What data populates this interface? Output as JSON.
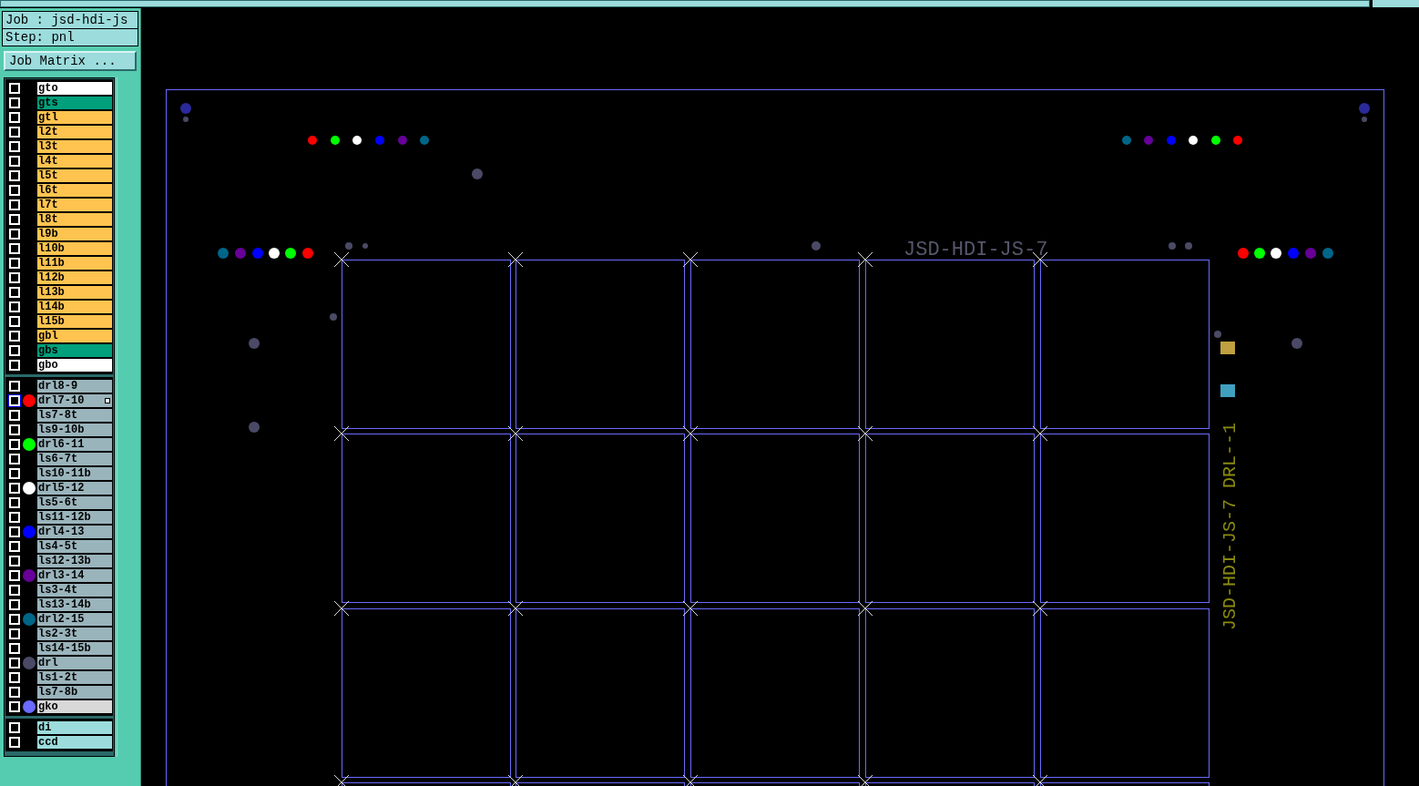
{
  "job": {
    "label": "Job : jsd-hdi-js",
    "step": "Step: pnl",
    "matrix_button": "Job Matrix ..."
  },
  "layer_groups": [
    {
      "layers": [
        {
          "name": "gto",
          "kind": "silk",
          "checked": false,
          "selected": false
        },
        {
          "name": "gts",
          "kind": "mask",
          "checked": false,
          "selected": false
        },
        {
          "name": "gtl",
          "kind": "signal",
          "checked": false,
          "selected": false
        },
        {
          "name": "l2t",
          "kind": "signal",
          "checked": false,
          "selected": false
        },
        {
          "name": "l3t",
          "kind": "signal",
          "checked": false,
          "selected": false
        },
        {
          "name": "l4t",
          "kind": "signal",
          "checked": false,
          "selected": false
        },
        {
          "name": "l5t",
          "kind": "signal",
          "checked": false,
          "selected": false
        },
        {
          "name": "l6t",
          "kind": "signal",
          "checked": false,
          "selected": false
        },
        {
          "name": "l7t",
          "kind": "signal",
          "checked": false,
          "selected": false
        },
        {
          "name": "l8t",
          "kind": "signal",
          "checked": false,
          "selected": false
        },
        {
          "name": "l9b",
          "kind": "signal",
          "checked": false,
          "selected": false
        },
        {
          "name": "l10b",
          "kind": "signal",
          "checked": false,
          "selected": false
        },
        {
          "name": "l11b",
          "kind": "signal",
          "checked": false,
          "selected": false
        },
        {
          "name": "l12b",
          "kind": "signal",
          "checked": false,
          "selected": false
        },
        {
          "name": "l13b",
          "kind": "signal",
          "checked": false,
          "selected": false
        },
        {
          "name": "l14b",
          "kind": "signal",
          "checked": false,
          "selected": false
        },
        {
          "name": "l15b",
          "kind": "signal",
          "checked": false,
          "selected": false
        },
        {
          "name": "gbl",
          "kind": "signal",
          "checked": false,
          "selected": false
        },
        {
          "name": "gbs",
          "kind": "mask",
          "checked": false,
          "selected": false
        },
        {
          "name": "gbo",
          "kind": "silk",
          "checked": false,
          "selected": false
        }
      ]
    },
    {
      "layers": [
        {
          "name": "drl8-9",
          "kind": "drill",
          "checked": false,
          "selected": false
        },
        {
          "name": "drl7-10",
          "kind": "drill",
          "checked": false,
          "selected": true,
          "color": "#ff0000"
        },
        {
          "name": "ls7-8t",
          "kind": "drill",
          "checked": false,
          "selected": false
        },
        {
          "name": "ls9-10b",
          "kind": "drill",
          "checked": false,
          "selected": false
        },
        {
          "name": "drl6-11",
          "kind": "drill",
          "checked": false,
          "selected": false,
          "color": "#00ff00"
        },
        {
          "name": "ls6-7t",
          "kind": "drill",
          "checked": false,
          "selected": false
        },
        {
          "name": "ls10-11b",
          "kind": "drill",
          "checked": false,
          "selected": false
        },
        {
          "name": "drl5-12",
          "kind": "drill",
          "checked": false,
          "selected": false,
          "color": "#ffffff"
        },
        {
          "name": "ls5-6t",
          "kind": "drill",
          "checked": false,
          "selected": false
        },
        {
          "name": "ls11-12b",
          "kind": "drill",
          "checked": false,
          "selected": false
        },
        {
          "name": "drl4-13",
          "kind": "drill",
          "checked": false,
          "selected": false,
          "color": "#0000ff"
        },
        {
          "name": "ls4-5t",
          "kind": "drill",
          "checked": false,
          "selected": false
        },
        {
          "name": "ls12-13b",
          "kind": "drill",
          "checked": false,
          "selected": false
        },
        {
          "name": "drl3-14",
          "kind": "drill",
          "checked": false,
          "selected": false,
          "color": "#660099"
        },
        {
          "name": "ls3-4t",
          "kind": "drill",
          "checked": false,
          "selected": false
        },
        {
          "name": "ls13-14b",
          "kind": "drill",
          "checked": false,
          "selected": false
        },
        {
          "name": "drl2-15",
          "kind": "drill",
          "checked": false,
          "selected": false,
          "color": "#006688"
        },
        {
          "name": "ls2-3t",
          "kind": "drill",
          "checked": false,
          "selected": false
        },
        {
          "name": "ls14-15b",
          "kind": "drill",
          "checked": false,
          "selected": false
        },
        {
          "name": "drl",
          "kind": "drill",
          "checked": false,
          "selected": false,
          "color": "#4a4a66"
        },
        {
          "name": "ls1-2t",
          "kind": "drill",
          "checked": false,
          "selected": false
        },
        {
          "name": "ls7-8b",
          "kind": "drill",
          "checked": false,
          "selected": false
        },
        {
          "name": "gko",
          "kind": "rout",
          "checked": false,
          "selected": false,
          "color": "#6a6aff"
        }
      ]
    },
    {
      "layers": [
        {
          "name": "di",
          "kind": "document",
          "checked": false,
          "selected": false
        },
        {
          "name": "ccd",
          "kind": "document",
          "checked": false,
          "selected": false
        }
      ]
    }
  ],
  "canvas": {
    "panel_title": "JSD-HDI-JS-7",
    "side_label": "JSD-HDI-JS-7 DRL--1"
  }
}
